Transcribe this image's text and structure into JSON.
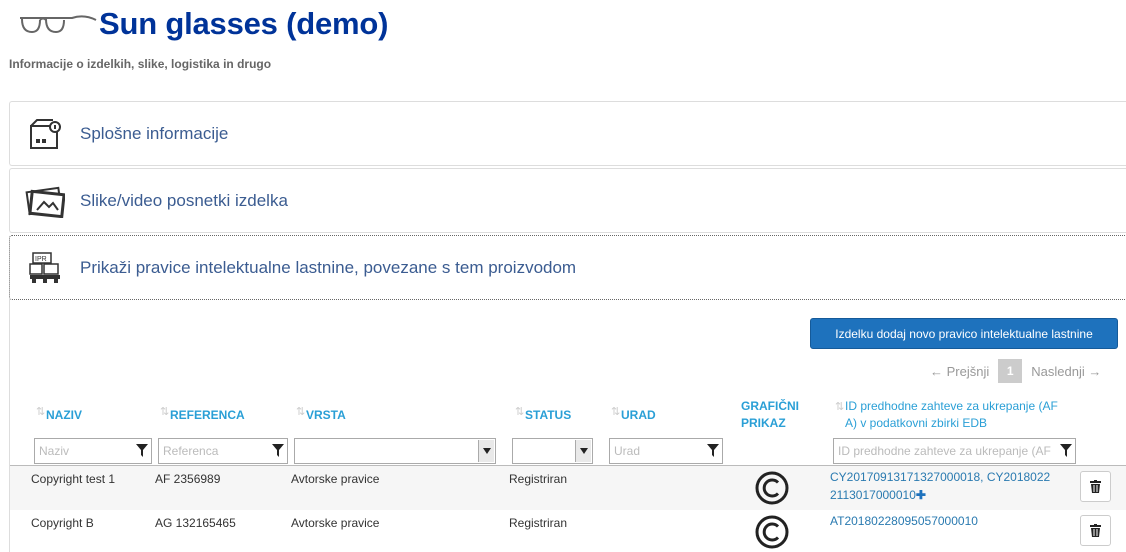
{
  "header": {
    "title": "Sun glasses (demo)",
    "subtitle": "Informacije o izdelkih, slike, logistika in drugo"
  },
  "panels": [
    {
      "label": "Splošne informacije",
      "icon": "box-info-icon"
    },
    {
      "label": "Slike/video posnetki izdelka",
      "icon": "photos-icon"
    },
    {
      "label": "Prikaži pravice intelektualne lastnine, povezane s tem proizvodom",
      "icon": "ipr-icon"
    }
  ],
  "actions": {
    "add_label": "Izdelku dodaj novo pravico intelektualne lastnine"
  },
  "pager": {
    "prev": "← Prejšnji",
    "page": "1",
    "next": "Naslednji →"
  },
  "table": {
    "headers": {
      "naziv": "NAZIV",
      "referenca": "REFERENCA",
      "vrsta": "VRSTA",
      "status": "STATUS",
      "urad": "URAD",
      "graficni_1": "GRAFIČNI",
      "graficni_2": "PRIKAZ",
      "id_1": "ID predhodne zahteve za ukrepanje (AF",
      "id_2": "A) v podatkovni zbirki EDB"
    },
    "filters": {
      "naziv": "Naziv",
      "referenca": "Referenca",
      "urad": "Urad",
      "id": "ID predhodne zahteve za ukrepanje (AF"
    },
    "rows": [
      {
        "naziv": "Copyright test 1",
        "referenca": "AF 2356989",
        "vrsta": "Avtorske pravice",
        "status": "Registriran",
        "id_line1": "CY20170913171327000018, CY2018022",
        "id_line2": "2113017000010",
        "id_more": "✚"
      },
      {
        "naziv": "Copyright B",
        "referenca": "AG 132165465",
        "vrsta": "Avtorske pravice",
        "status": "Registriran",
        "id_line1": "AT20180228095057000010",
        "id_line2": "",
        "id_more": ""
      }
    ]
  },
  "colors": {
    "title": "#003399",
    "panel_label": "#3b5c91",
    "column_header": "#2a9fd6",
    "button": "#1e72bd",
    "link": "#2a7ab0"
  }
}
